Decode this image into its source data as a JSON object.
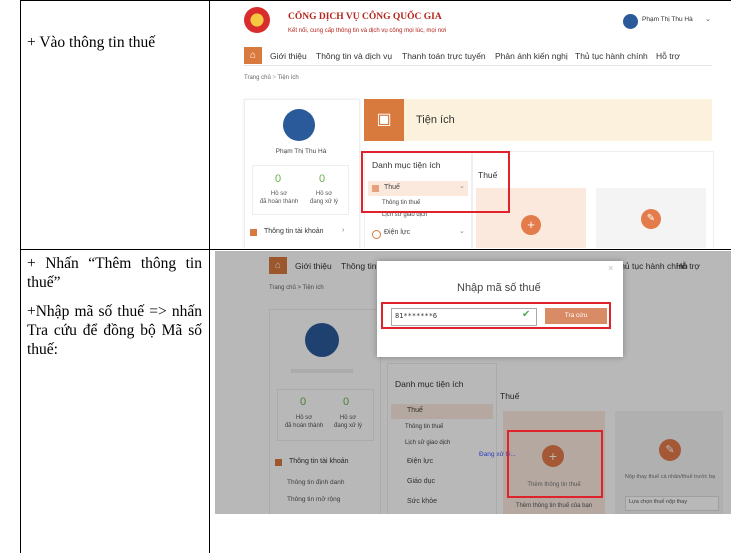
{
  "row1": {
    "instruction": "+ Vào thông tin thuế"
  },
  "row2": {
    "instruction1": "+ Nhấn “Thêm thông tin thuế”",
    "instruction2": "+Nhập mã số thuế => nhấn Tra cứu để đồng bộ Mã số thuế:"
  },
  "portal": {
    "title": "CỔNG DỊCH VỤ CÔNG QUỐC GIA",
    "slogan": "Kết nối, cung cấp thông tin và dịch vụ công mọi lúc, mọi nơi",
    "user_name": "Phạm Thị Thu Hà",
    "nav": [
      "Giới thiệu",
      "Thông tin và dịch vụ",
      "Thanh toán trực tuyến",
      "Phản ánh kiến nghị",
      "Thủ tục hành chính",
      "Hỗ trợ"
    ],
    "breadcrumb_home": "Trang chủ",
    "breadcrumb_sep": ">",
    "breadcrumb_current": "Tiện ích",
    "utility_title": "Tiện ích",
    "stat_completed_value": "0",
    "stat_completed_label1": "Hồ sơ",
    "stat_completed_label2": "đã hoàn thành",
    "stat_processing_value": "0",
    "stat_processing_label1": "Hồ sơ",
    "stat_processing_label2": "đang xử lý",
    "account_info": "Thông tin tài khoản",
    "menu_title": "Danh mục tiện ích",
    "menu_tax": "Thuế",
    "menu_tax_info": "Thông tin thuế",
    "menu_tx_history": "Lịch sử giao dịch",
    "menu_electric": "Điện lực",
    "menu_education": "Giáo dục",
    "menu_health": "Sức khỏe",
    "tax_heading": "Thuế",
    "identity_info": "Thông tin định danh",
    "extended_info": "Thông tin mở rộng",
    "add_tax_info": "Thêm thông tin thuế",
    "add_tax_sub": "Thêm thông tin thuế của bạn",
    "update_tax": "Nộp thay thuế cá nhân/thuế trước bạ",
    "choose_payer": "Lựa chọn thuế nộp thay",
    "processing": "Đang xử lý...",
    "dialog_title": "Nhập mã số thuế",
    "tax_code_value": "81*******6",
    "lookup_button": "Tra cứu",
    "close_x": "×",
    "check": "✔"
  }
}
